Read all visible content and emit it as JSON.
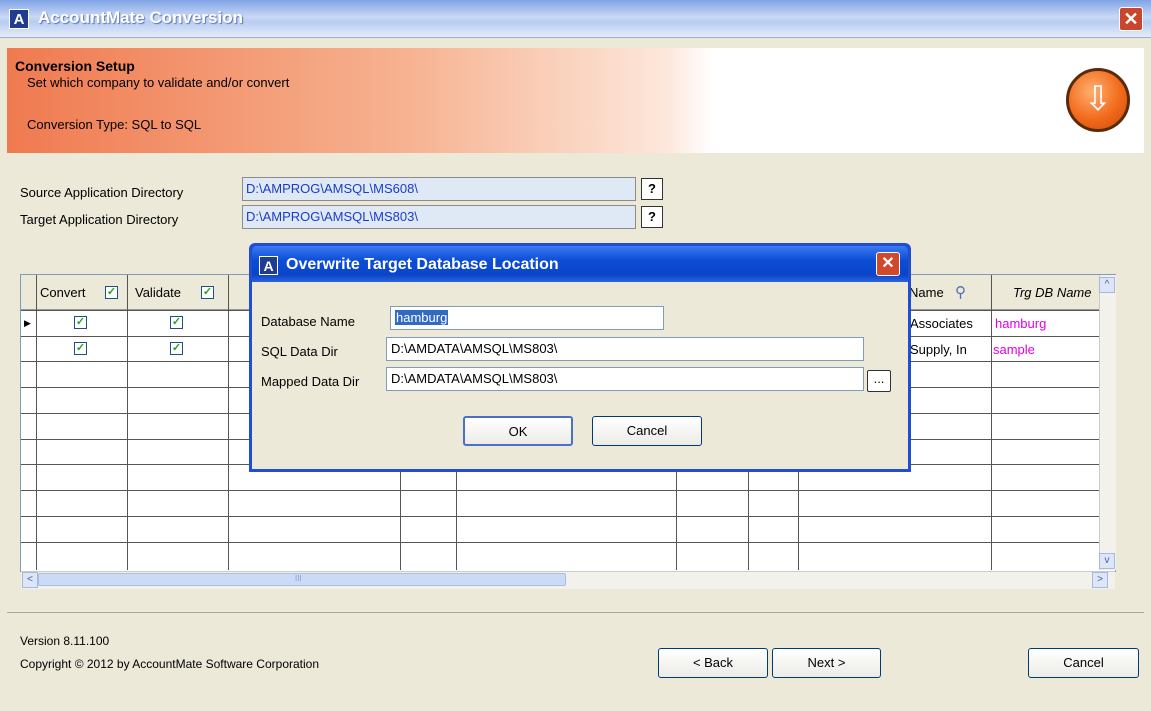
{
  "window": {
    "title": "AccountMate Conversion",
    "logo_letter": "A",
    "close_glyph": "✕"
  },
  "header": {
    "title": "Conversion Setup",
    "subtitle": "Set which company to validate and/or convert",
    "conversion_type": "Conversion Type: SQL to SQL",
    "icon": "download-arrow-icon"
  },
  "directories": {
    "source_label": "Source Application Directory",
    "source_value": "D:\\AMPROG\\AMSQL\\MS608\\",
    "target_label": "Target Application Directory",
    "target_value": "D:\\AMPROG\\AMSQL\\MS803\\",
    "help_glyph": "?"
  },
  "grid": {
    "columns": {
      "convert": "Convert",
      "validate": "Validate",
      "name": "Name",
      "trg_db_name": "Trg DB Name"
    },
    "rows": [
      {
        "convert": true,
        "validate": true,
        "name": "Associates",
        "trg_db": "hamburg"
      },
      {
        "convert": true,
        "validate": true,
        "name": "Supply, In",
        "trg_db": "sample"
      }
    ],
    "check_glyph": "✓",
    "scroll_left": "<",
    "scroll_right": ">",
    "scroll_up": "^",
    "scroll_down": "v",
    "thumb_grip": "III"
  },
  "footer": {
    "version": "Version 8.11.100",
    "copyright": "Copyright © 2012 by AccountMate Software Corporation",
    "back_label": "< Back",
    "next_label": "Next >",
    "cancel_label": "Cancel"
  },
  "dialog": {
    "title": "Overwrite Target Database Location",
    "logo_letter": "A",
    "close_glyph": "✕",
    "db_name_label": "Database Name",
    "db_name_value": "hamburg",
    "sql_dir_label": "SQL Data Dir",
    "sql_dir_value": "D:\\AMDATA\\AMSQL\\MS803\\",
    "mapped_dir_label": "Mapped Data Dir",
    "mapped_dir_value": "D:\\AMDATA\\AMSQL\\MS803\\",
    "browse_label": "...",
    "ok_label": "OK",
    "cancel_label": "Cancel"
  },
  "colors": {
    "accent": "#0a45c8",
    "link_text": "#1a3ccc",
    "trg_db_text": "#e000e0"
  }
}
